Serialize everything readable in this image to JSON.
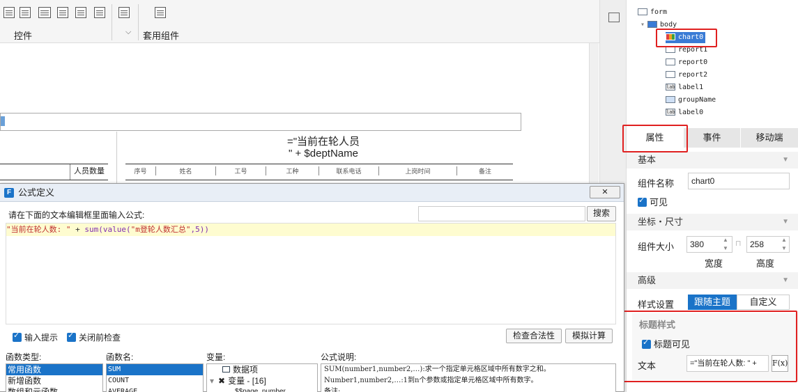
{
  "toolbar": {
    "controls_label": "控件",
    "kit_label": "套用组件"
  },
  "canvas": {
    "title_line1": "=\"当前在轮人员",
    "title_line2": "\" + $deptName",
    "header_left": "人员数量",
    "headers": [
      "序号",
      "姓名",
      "工号",
      "工种",
      "联系电话",
      "上岗时间",
      "备注"
    ]
  },
  "tree": {
    "items": [
      {
        "label": "form"
      },
      {
        "label": "body"
      },
      {
        "label": "chart0"
      },
      {
        "label": "report1"
      },
      {
        "label": "report0"
      },
      {
        "label": "report2"
      },
      {
        "label": "label1"
      },
      {
        "label": "groupName"
      },
      {
        "label": "label0"
      }
    ],
    "label_icon_text": "lab"
  },
  "props": {
    "tabs": [
      "属性",
      "事件",
      "移动端"
    ],
    "basic": "基本",
    "name_label": "组件名称",
    "name_value": "chart0",
    "visible_label": "可见",
    "coord_section": "坐标・尺寸",
    "size_label": "组件大小",
    "width_value": "380",
    "height_value": "258",
    "width_label": "宽度",
    "height_label": "高度",
    "advanced": "高级",
    "style_label": "样式设置",
    "style_follow": "跟随主题",
    "style_custom": "自定义",
    "title_style": "标题样式",
    "title_visible": "标题可见",
    "text_label": "文本",
    "text_value": "=\"当前在轮人数: \" +",
    "fx_label": "F(x)"
  },
  "dialog": {
    "title": "公式定义",
    "prompt": "请在下面的文本编辑框里面输入公式:",
    "search_btn": "搜索",
    "search_placeholder": "",
    "formula_str": "\"当前在轮人数: \"",
    "formula_plus": " + ",
    "formula_fn": "sum(value(",
    "formula_arg": "\"m登轮人数汇总\"",
    "formula_end": ",5))",
    "input_hint": "输入提示",
    "check_before_close": "关闭前检查",
    "check_btn": "检查合法性",
    "simulate_btn": "模拟计算",
    "fn_type_label": "函数类型:",
    "fn_name_label": "函数名:",
    "var_label": "变量:",
    "desc_label": "公式说明:",
    "fn_types": [
      "常用函数",
      "新增函数",
      "数组和元函数"
    ],
    "fn_names": [
      "SUM",
      "COUNT",
      "AVERAGE"
    ],
    "var_items": [
      "数据项",
      "变量 - [16]",
      "$$page_number"
    ],
    "desc_lines": [
      "SUM(number1,number2,…):求一个指定单元格区域中所有数字之和。",
      "Number1,number2,…:1到n个参数或指定单元格区域中所有数字。",
      "备注:"
    ]
  }
}
